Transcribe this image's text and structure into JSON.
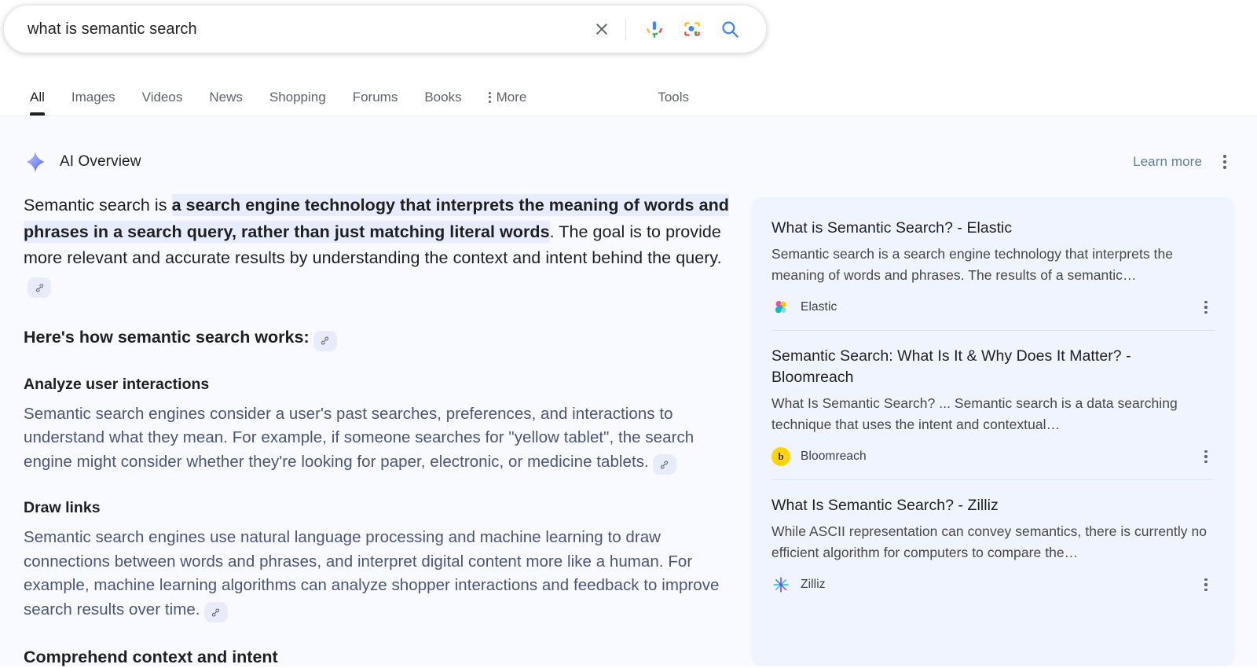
{
  "search": {
    "query": "what is semantic search",
    "placeholder": "Search",
    "clear_icon": "close-icon",
    "voice_icon": "microphone-icon",
    "lens_icon": "google-lens-icon",
    "submit_icon": "search-icon"
  },
  "tabs": [
    {
      "label": "All",
      "active": true
    },
    {
      "label": "Images",
      "active": false
    },
    {
      "label": "Videos",
      "active": false
    },
    {
      "label": "News",
      "active": false
    },
    {
      "label": "Shopping",
      "active": false
    },
    {
      "label": "Forums",
      "active": false
    },
    {
      "label": "Books",
      "active": false
    },
    {
      "label": "More",
      "active": false
    }
  ],
  "tools_label": "Tools",
  "ai_overview": {
    "title": "AI Overview",
    "sparkle_icon": "ai-sparkle-icon",
    "learn_more": "Learn more",
    "intro": {
      "lead": "Semantic search is ",
      "highlight": "a search engine technology that interprets the meaning of words and phrases in a search query, rather than just matching literal words",
      "tail": ". The goal is to provide more relevant and accurate results by understanding the context and intent behind the query."
    },
    "works_heading": "Here's how semantic search works:",
    "sections": [
      {
        "heading": "Analyze user interactions",
        "body": "Semantic search engines consider a user's past searches, preferences, and interactions to understand what they mean. For example, if someone searches for \"yellow tablet\", the search engine might consider whether they're looking for paper, electronic, or medicine tablets."
      },
      {
        "heading": "Draw links",
        "body": "Semantic search engines use natural language processing and machine learning to draw connections between words and phrases, and interpret digital content more like a human. For example, machine learning algorithms can analyze shopper interactions and feedback to improve search results over time."
      }
    ],
    "cut_off_heading": "Comprehend context and intent"
  },
  "source_cards": [
    {
      "title": "What is Semantic Search? - Elastic",
      "snippet": "Semantic search is a search engine technology that interprets the meaning of words and phrases. The results of a semantic…",
      "source": "Elastic",
      "favicon": "elastic-logo-icon"
    },
    {
      "title": "Semantic Search: What Is It & Why Does It Matter? - Bloomreach",
      "snippet": "What Is Semantic Search? ... Semantic search is a data searching technique that uses the intent and contextual…",
      "source": "Bloomreach",
      "favicon": "bloomreach-logo-icon",
      "favicon_letter": "b"
    },
    {
      "title": "What Is Semantic Search? - Zilliz",
      "snippet": "While ASCII representation can convey semantics, there is currently no efficient algorithm for computers to compare the…",
      "source": "Zilliz",
      "favicon": "zilliz-logo-icon"
    }
  ],
  "colors": {
    "page_bg": "#f8faff",
    "card_panel_bg": "#f0f4fe",
    "highlight_bg": "#e8edfd",
    "body_text": "#4a5578",
    "heading_text": "#1f1f1f",
    "google_blue": "#4285f4",
    "google_red": "#ea4335",
    "google_yellow": "#fbbc05",
    "google_green": "#34a853"
  }
}
